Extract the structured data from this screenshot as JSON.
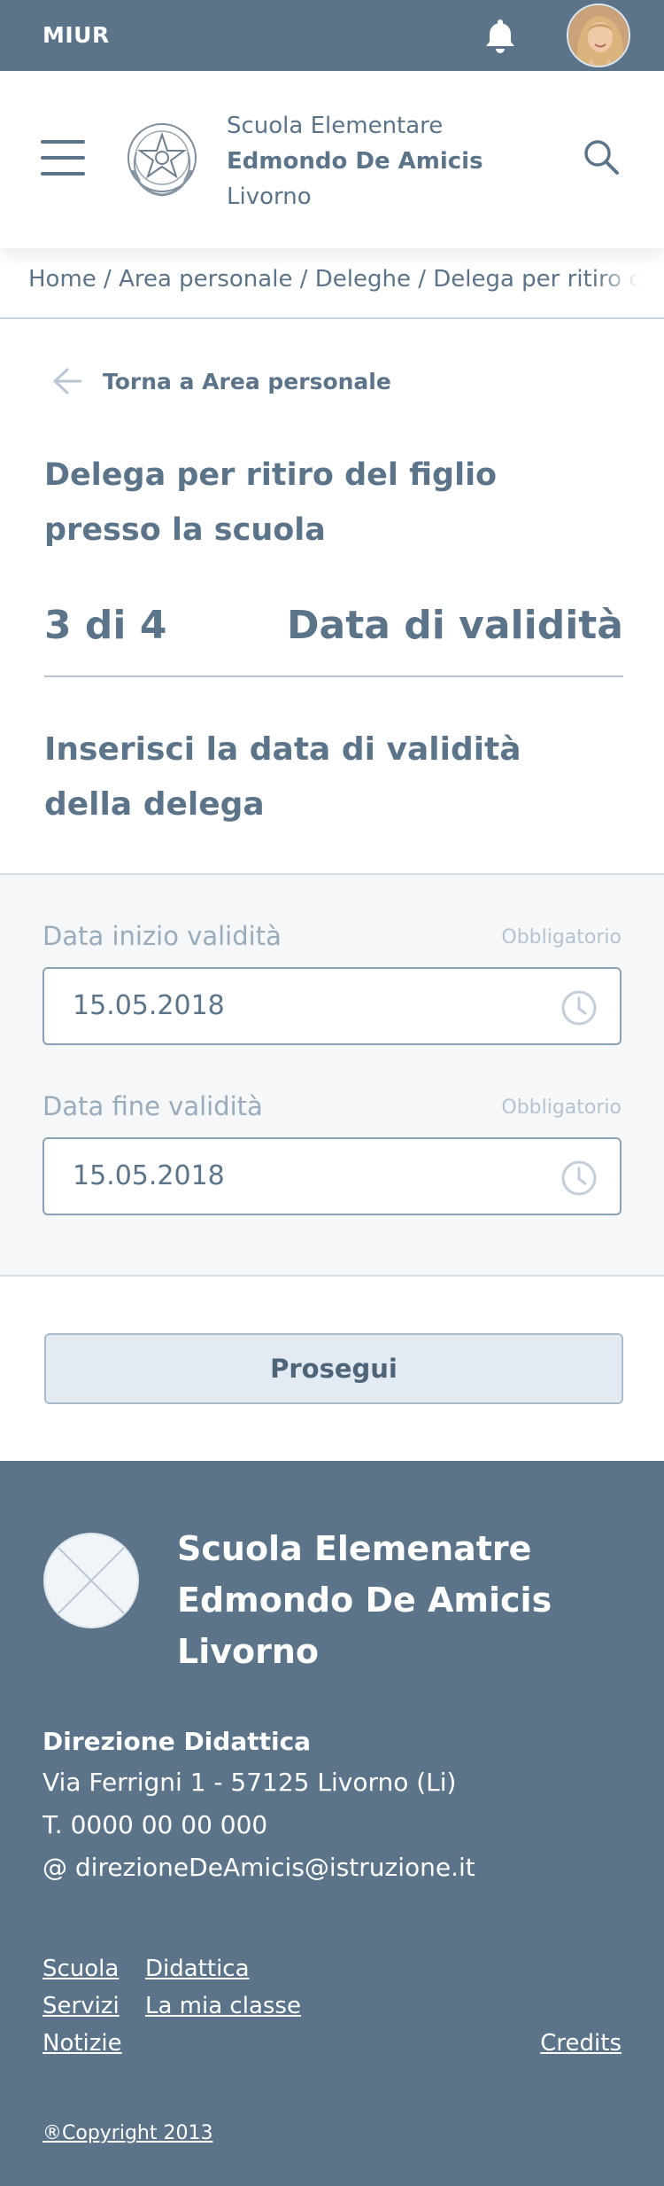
{
  "topbar": {
    "brand": "MIUR",
    "bell_icon": "bell-icon",
    "avatar_icon": "user-avatar"
  },
  "header": {
    "menu_icon": "hamburger-icon",
    "emblem_icon": "italian-republic-emblem",
    "school_line1": "Scuola Elementare",
    "school_line2": "Edmondo De Amicis",
    "school_line3": "Livorno",
    "search_icon": "search-icon"
  },
  "breadcrumb": {
    "text": "Home / Area personale / Deleghe / Delega per ritiro del figlio presso la scuola"
  },
  "back_link": {
    "label": "Torna a Area personale",
    "icon": "arrow-left-icon"
  },
  "page": {
    "title": "Delega per ritiro del figlio presso la scuola",
    "step_number": "3 di 4",
    "step_name": "Data di validità",
    "instruction": "Inserisci la data di validità della delega"
  },
  "form": {
    "start": {
      "label": "Data inizio validità",
      "required": "Obbligatorio",
      "value": "15.05.2018",
      "icon": "clock-icon"
    },
    "end": {
      "label": "Data fine validità",
      "required": "Obbligatorio",
      "value": "15.05.2018",
      "icon": "clock-icon"
    }
  },
  "actions": {
    "continue_label": "Prosegui"
  },
  "footer": {
    "school_line1": "Scuola Elemenatre",
    "school_line2": "Edmondo De Amicis",
    "school_line3": "Livorno",
    "direction_title": "Direzione Didattica",
    "address": "Via Ferrigni 1 - 57125 Livorno (Li)",
    "phone": "T. 0000 00 00 000",
    "email": "@ direzioneDeAmicis@istruzione.it",
    "links": {
      "scuola": "Scuola",
      "didattica": "Didattica",
      "servizi": "Servizi",
      "la_mia_classe": "La mia classe",
      "notizie": "Notizie",
      "credits": "Credits"
    },
    "copyright": "®Copyright 2013"
  },
  "colors": {
    "primary": "#5c7489",
    "muted_text": "#9aabbb",
    "form_bg": "#f5f7f9",
    "button_bg": "#e4eaf1"
  }
}
